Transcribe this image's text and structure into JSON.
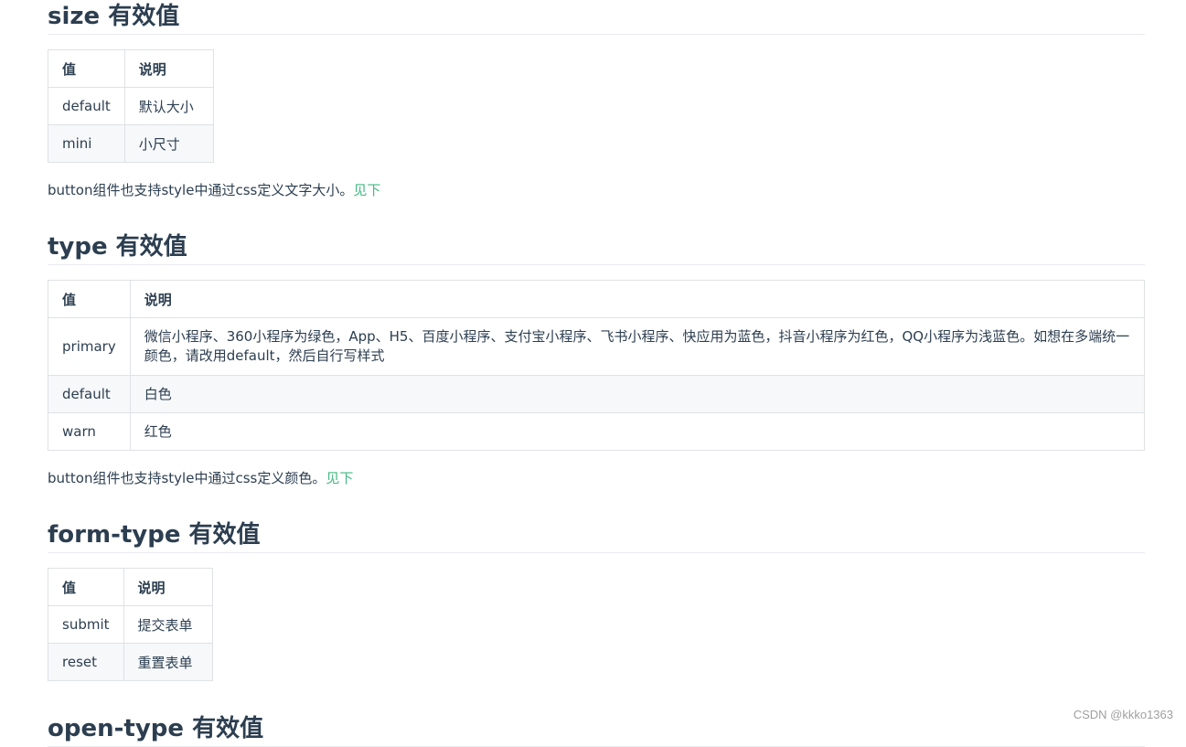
{
  "sections": [
    {
      "title": "size 有效值",
      "headers": [
        "值",
        "说明"
      ],
      "rows": [
        [
          "default",
          "默认大小"
        ],
        [
          "mini",
          "小尺寸"
        ]
      ],
      "note": "button组件也支持style中通过css定义文字大小。",
      "note_link": "见下"
    },
    {
      "title": "type 有效值",
      "headers": [
        "值",
        "说明"
      ],
      "rows": [
        [
          "primary",
          "微信小程序、360小程序为绿色，App、H5、百度小程序、支付宝小程序、飞书小程序、快应用为蓝色，抖音小程序为红色，QQ小程序为浅蓝色。如想在多端统一颜色，请改用default，然后自行写样式"
        ],
        [
          "default",
          "白色"
        ],
        [
          "warn",
          "红色"
        ]
      ],
      "note": "button组件也支持style中通过css定义颜色。",
      "note_link": "见下"
    },
    {
      "title": "form-type 有效值",
      "headers": [
        "值",
        "说明"
      ],
      "rows": [
        [
          "submit",
          "提交表单"
        ],
        [
          "reset",
          "重置表单"
        ]
      ]
    },
    {
      "title": "open-type 有效值"
    }
  ],
  "watermark": "CSDN @kkko1363",
  "colors": {
    "link": "#42b983",
    "heading": "#2c3e50",
    "border": "#dfe2e5",
    "stripe": "#f6f8fa"
  }
}
